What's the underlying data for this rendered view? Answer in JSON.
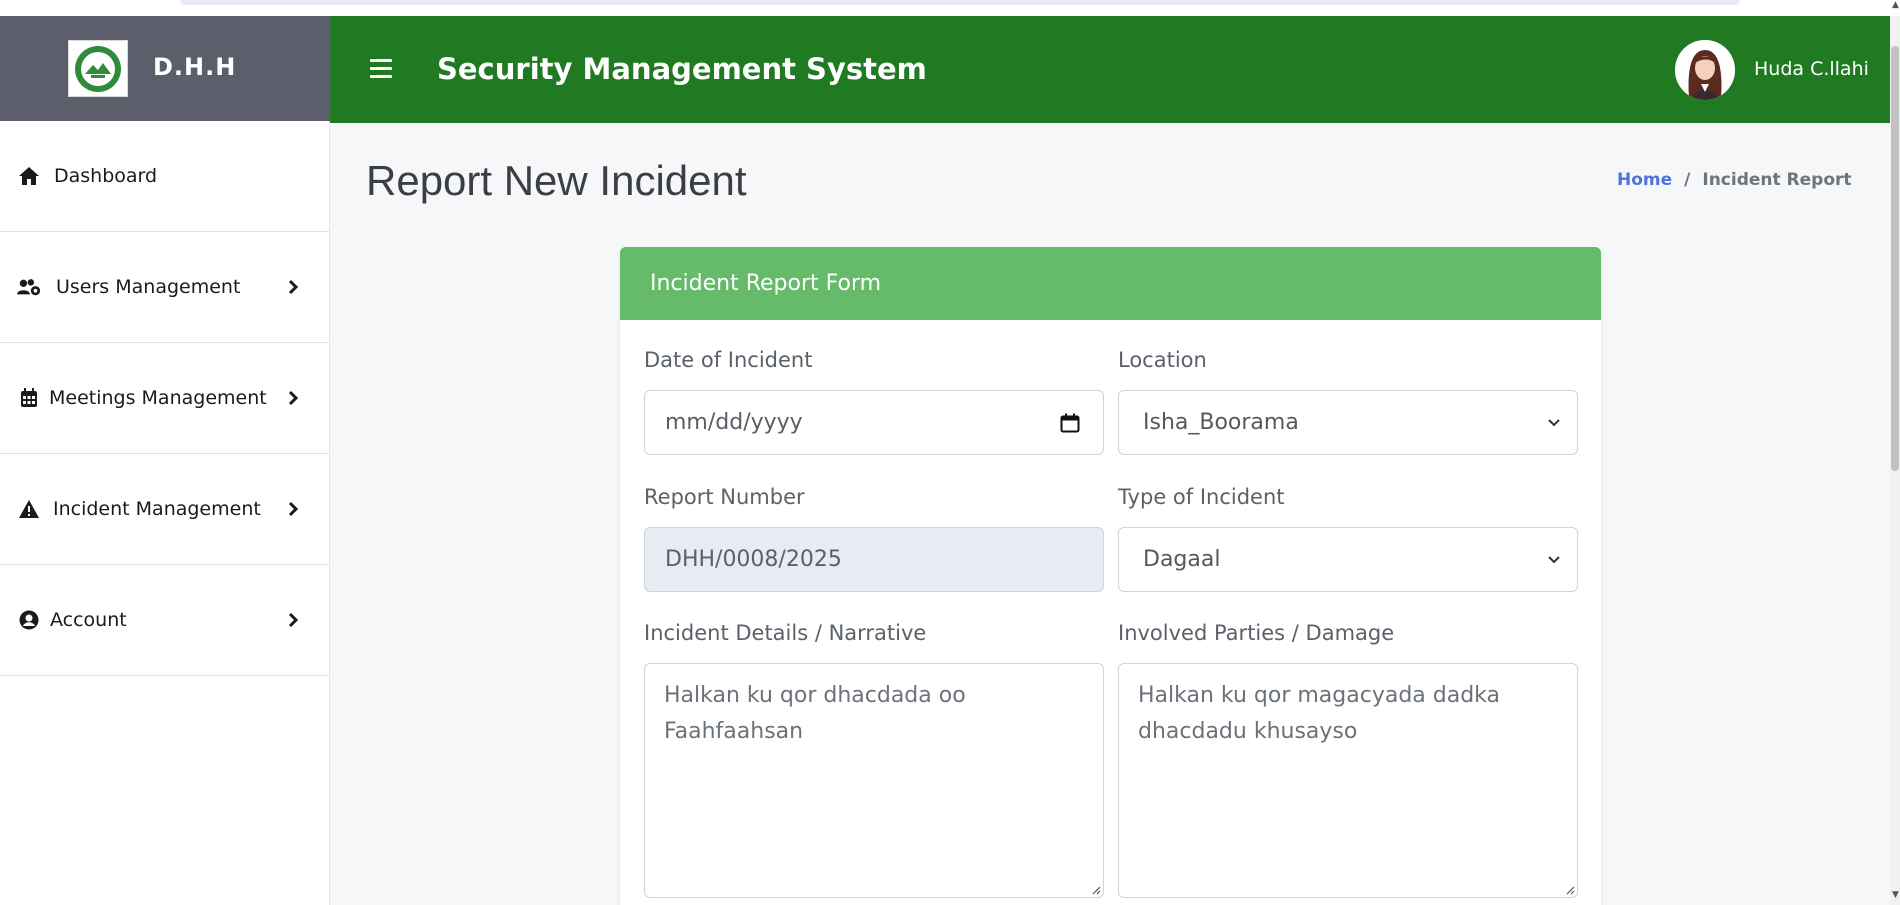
{
  "brand": {
    "name": "D.H.H"
  },
  "sidebar": {
    "items": [
      {
        "label": "Dashboard",
        "icon": "home-icon",
        "has_submenu": false
      },
      {
        "label": "Users Management",
        "icon": "users-cog-icon",
        "has_submenu": true
      },
      {
        "label": "Meetings Management",
        "icon": "calendar-icon",
        "has_submenu": true
      },
      {
        "label": "Incident Management",
        "icon": "warning-icon",
        "has_submenu": true
      },
      {
        "label": "Account",
        "icon": "user-circle-icon",
        "has_submenu": true
      }
    ]
  },
  "header": {
    "title": "Security Management System",
    "user_name": "Huda C.llahi"
  },
  "page": {
    "title": "Report New Incident",
    "breadcrumb": {
      "home": "Home",
      "separator": "/",
      "current": "Incident Report"
    }
  },
  "form": {
    "header": "Incident Report Form",
    "date": {
      "label": "Date of Incident",
      "placeholder": "mm/dd/yyyy"
    },
    "location": {
      "label": "Location",
      "value": "Isha_Boorama"
    },
    "report_number": {
      "label": "Report Number",
      "value": "DHH/0008/2025"
    },
    "incident_type": {
      "label": "Type of Incident",
      "value": "Dagaal"
    },
    "details": {
      "label": "Incident Details / Narrative",
      "placeholder": "Halkan ku qor dhacdada oo Faahfaahsan"
    },
    "parties": {
      "label": "Involved Parties / Damage",
      "placeholder": "Halkan ku qor magacyada dadka dhacdadu khusayso"
    }
  },
  "colors": {
    "header_green": "#1f7a22",
    "card_header_green": "#66bb6a",
    "brand_gray": "#5c5e6b",
    "link_blue": "#4e73df"
  }
}
